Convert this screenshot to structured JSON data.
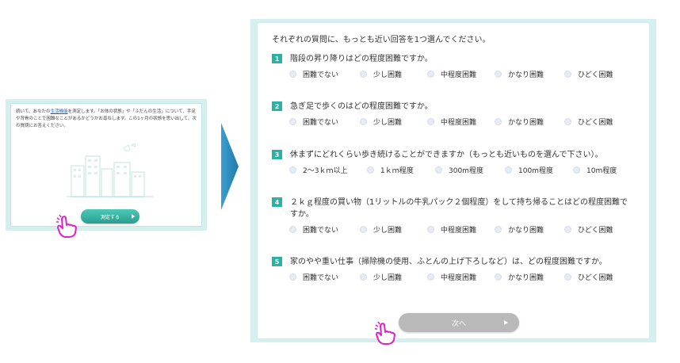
{
  "left": {
    "intro_before_link": "続いて、あなたの",
    "intro_link": "生活機能",
    "intro_after_link": "を測定します。「お体の状態」や「ふだんの生活」について、手足や背骨のことで困難なことがあるかどうかお尋ねします。この1ヶ月の状態を思い出して、次の質問にお答えください。",
    "measure_button_label": "測定する"
  },
  "right": {
    "instruction": "それぞれの質問に、もっとも近い回答を1つ選んでください。",
    "questions": [
      {
        "number": "1",
        "text": "階段の昇り降りはどの程度困難ですか。",
        "options": [
          "困難でない",
          "少し困難",
          "中程度困難",
          "かなり困難",
          "ひどく困難"
        ]
      },
      {
        "number": "2",
        "text": "急ぎ足で歩くのはどの程度困難ですか。",
        "options": [
          "困難でない",
          "少し困難",
          "中程度困難",
          "かなり困難",
          "ひどく困難"
        ]
      },
      {
        "number": "3",
        "text": "休まずにどれくらい歩き続けることができますか（もっとも近いものを選んで下さい）。",
        "options": [
          "2～3ｋｍ以上",
          "1ｋｍ程度",
          "300m程度",
          "100m程度",
          "10m程度"
        ]
      },
      {
        "number": "4",
        "text": "２ｋｇ程度の買い物（1リットルの牛乳パック２個程度）をして持ち帰ることはどの程度困難ですか。",
        "options": [
          "困難でない",
          "少し困難",
          "中程度困難",
          "かなり困難",
          "ひどく困難"
        ]
      },
      {
        "number": "5",
        "text": "家のやや重い仕事（掃除機の使用、ふとんの上げ下ろしなど）は、どの程度困難ですか。",
        "options": [
          "困難でない",
          "少し困難",
          "中程度困難",
          "かなり困難",
          "ひどく困難"
        ]
      }
    ],
    "next_button_label": "次へ"
  },
  "colors": {
    "panel_bg": "#d4f0ee",
    "accent_teal": "#2ab3a3",
    "next_button": "#b9b9b9",
    "pointer_magenta": "#e020c8",
    "arrow_blue": "#2f8fc0"
  },
  "icons": [
    "city-illustration-icon",
    "pointing-hand-icon",
    "chevron-right-arrow-icon",
    "play-arrow-icon"
  ]
}
